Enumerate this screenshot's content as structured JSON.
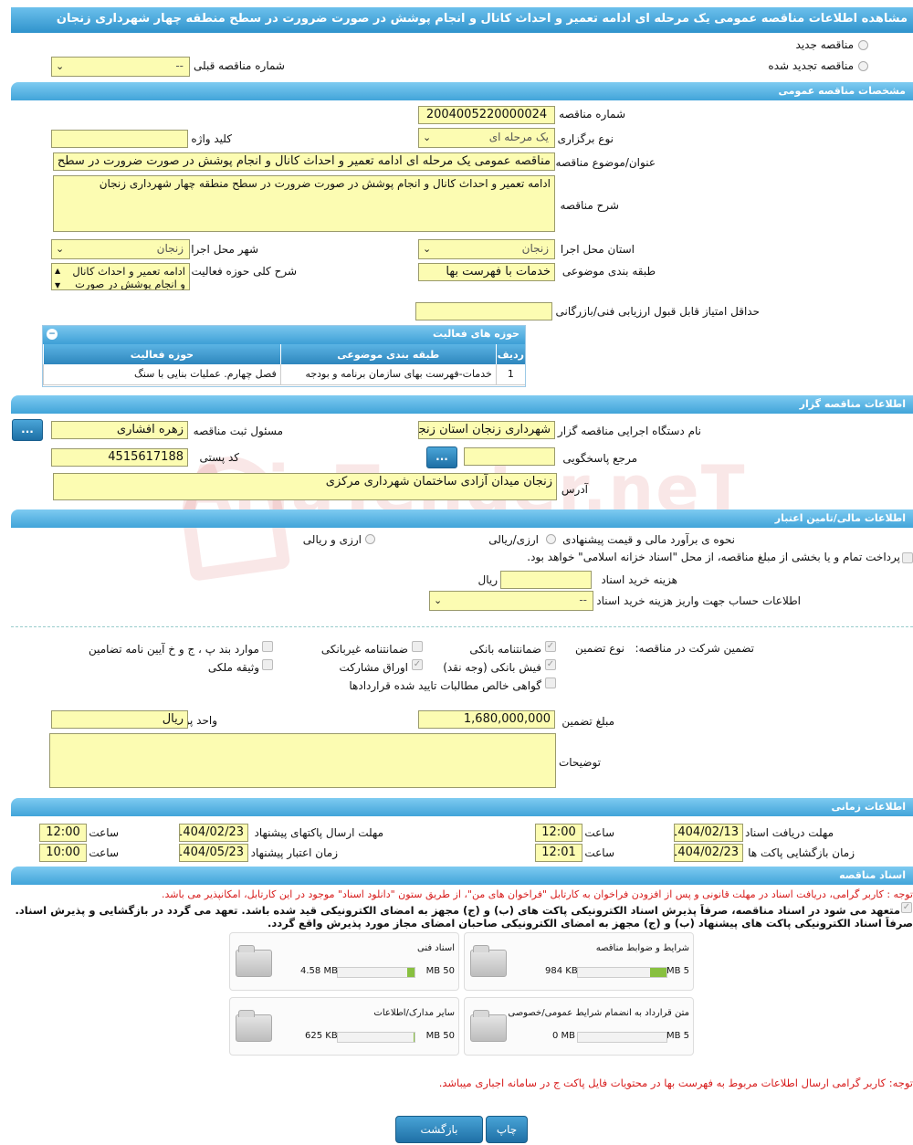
{
  "title": "مشاهده اطلاعات مناقصه عمومی یک مرحله ای ادامه تعمیر و احداث کانال و انجام پوشش در صورت ضرورت در سطح منطقه چهار شهرداری زنجان",
  "top": {
    "new_tender_label": "مناقصه جدید",
    "renewed_tender_label": "مناقصه تجدید شده",
    "prev_number_label": "شماره مناقصه قبلی",
    "prev_number_value": "--"
  },
  "general": {
    "header": "مشخصات مناقصه عمومی",
    "number_label": "شماره مناقصه",
    "number_value": "2004005220000024",
    "type_label": "نوع برگزاری",
    "type_value": "یک مرحله ای",
    "keyword_label": "کلید واژه",
    "keyword_value": "",
    "subject_label": "عنوان/موضوع مناقصه",
    "subject_value": "مناقصه عمومی یک مرحله ای ادامه تعمیر و احداث کانال و انجام پوشش در صورت ضرورت در سطح منطقه چهار شهرداری زنجان",
    "desc_label": "شرح مناقصه",
    "desc_value": "ادامه تعمیر و احداث کانال و انجام پوشش در صورت ضرورت در سطح منطقه چهار شهرداری زنجان",
    "province_label": "استان محل اجرا",
    "province_value": "زنجان",
    "city_label": "شهر محل اجرا",
    "city_value": "زنجان",
    "category_label": "طبقه بندی موضوعی",
    "category_value": "خدمات با فهرست بها",
    "scope_label": "شرح کلی حوزه فعالیت",
    "scope_value": "ادامه تعمیر و احداث کانال و انجام پوشش در صورت",
    "min_score_label": "حداقل امتیاز قابل قبول ارزیابی فنی/بازرگانی",
    "min_score_value": ""
  },
  "activity": {
    "header": "حوزه های فعالیت",
    "col_row": "ردیف",
    "col_category": "طبقه بندی موضوعی",
    "col_scope": "حوزه فعالیت",
    "rows": [
      {
        "n": "1",
        "category": "خدمات-فهرست بهای سازمان برنامه و بودجه",
        "scope": "فصل چهارم. عملیات بنایی با سنگ"
      }
    ]
  },
  "organizer": {
    "header": "اطلاعات مناقصه گزار",
    "org_label": "نام دستگاه اجرایی مناقصه گزار",
    "org_value": "شهرداری زنجان استان زنجان",
    "registrar_label": "مسئول ثبت مناقصه",
    "registrar_value": "زهره افشاری",
    "ref_label": "مرجع پاسخگویی",
    "ref_value": "",
    "postal_label": "کد پستی",
    "postal_value": "4515617188",
    "address_label": "آدرس",
    "address_value": "زنجان میدان آزادی ساختمان شهرداری مرکزی",
    "dots": "..."
  },
  "finance": {
    "header": "اطلاعات مالی/تامین اعتبار",
    "estimate_label": "نحوه ی برآورد مالی و قیمت پیشنهادی",
    "opt1": "ارزی/ریالی",
    "opt2": "ارزی و ریالی",
    "treasury_note": "پرداخت تمام و یا بخشی از مبلغ مناقصه، از محل \"اسناد خزانه اسلامی\" خواهد بود.",
    "doc_cost_label": "هزینه خرید اسناد",
    "doc_cost_unit": "ریال",
    "doc_cost_value": "",
    "account_label": "اطلاعات حساب جهت واریز هزینه خرید اسناد",
    "account_value": "--"
  },
  "guarantee": {
    "label": "تضمین شرکت در مناقصه:",
    "type_label": "نوع تضمین",
    "opts": {
      "bank_guarantee": "ضمانتنامه بانکی",
      "non_bank_guarantee": "ضمانتنامه غیربانکی",
      "items_rule": "موارد بند پ ، ج و خ آیین نامه تضامین",
      "bank_receipt": "فیش بانکی (وجه نقد)",
      "bonds": "اوراق مشارکت",
      "property": "وثیقه ملکی",
      "claims": "گواهی خالص مطالبات تایید شده قراردادها"
    },
    "amount_label": "مبلغ تضمین",
    "amount_value": "1,680,000,000",
    "currency_label": "واحد پول",
    "currency_value": "ریال",
    "notes_label": "توضیحات",
    "notes_value": ""
  },
  "timing": {
    "header": "اطلاعات زمانی",
    "receive_deadline_label": "مهلت دریافت اسناد",
    "receive_deadline_date": "1404/02/13",
    "receive_deadline_time": "12:00",
    "send_deadline_label": "مهلت ارسال پاکتهای پیشنهاد",
    "send_deadline_date": "1404/02/23",
    "send_deadline_time": "12:00",
    "open_label": "زمان بازگشایی پاکت ها",
    "open_date": "1404/02/23",
    "open_time": "12:01",
    "validity_label": "زمان اعتبار پیشنهاد",
    "validity_date": "1404/05/23",
    "validity_time": "10:00",
    "time_label": "ساعت"
  },
  "docs": {
    "header": "اسناد مناقصه",
    "note1": "توجه : کاربر گرامی، دریافت اسناد در مهلت قانونی و پس از افزودن فراخوان به کارتابل \"فراخوان های من\"، از طریق ستون \"دانلود اسناد\" موجود در این کارتابل، امکانپذیر می باشد.",
    "note2": "متعهد می شود در اسناد مناقصه، صرفاً پذیرش اسناد الکترونیکی پاکت های (ب) و (ج) مجهز به امضای الکترونیکی قید شده باشد. تعهد می گردد در بازگشایی و پذیرش اسناد.",
    "note3": "صرفاً اسناد الکترونیکی پاکت های پیشنهاد (ب) و (ج) مجهز به امضای الکترونیکی صاحبان امضای مجاز مورد پذیرش واقع گردد.",
    "files": [
      {
        "name": "شرایط و ضوابط مناقصه",
        "size": "984 KB",
        "max": "5 MB",
        "fraction": 0.19
      },
      {
        "name": "اسناد فنی",
        "size": "4.58 MB",
        "max": "50 MB",
        "fraction": 0.09
      },
      {
        "name": "متن قرارداد به انضمام شرایط عمومی/خصوصی",
        "size": "0 MB",
        "max": "5 MB",
        "fraction": 0.0
      },
      {
        "name": "سایر مدارک/اطلاعات",
        "size": "625 KB",
        "max": "50 MB",
        "fraction": 0.012
      }
    ],
    "note4": "توجه: کاربر گرامی ارسال اطلاعات مربوط به فهرست بها در محتویات فایل پاکت ج در سامانه اجباری میباشد."
  },
  "buttons": {
    "print": "چاپ",
    "back": "بازگشت"
  },
  "watermark": "AriaTender.neT"
}
